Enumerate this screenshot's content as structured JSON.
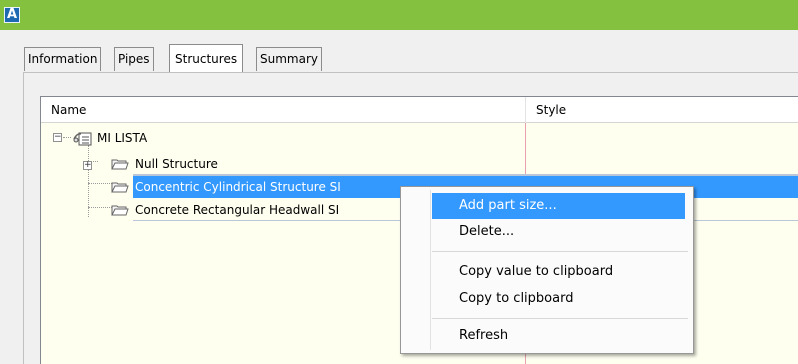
{
  "app": {
    "icon_letter": "A"
  },
  "tabs": [
    {
      "label": "Information"
    },
    {
      "label": "Pipes"
    },
    {
      "label": "Structures"
    },
    {
      "label": "Summary"
    }
  ],
  "grid": {
    "columns": {
      "name": "Name",
      "style": "Style"
    },
    "rows": [
      {
        "label": "MI LISTA"
      },
      {
        "label": "Null Structure"
      },
      {
        "label": "Concentric Cylindrical Structure SI"
      },
      {
        "label": "Concrete Rectangular Headwall SI"
      }
    ]
  },
  "context_menu": {
    "items": [
      {
        "label": "Add part size..."
      },
      {
        "label": "Delete..."
      },
      {
        "label": "Copy value to clipboard"
      },
      {
        "label": "Copy to clipboard"
      },
      {
        "label": "Refresh"
      }
    ]
  },
  "colors": {
    "titlebar": "#84c13f",
    "selection": "#3399ff",
    "grid_bg": "#fffff0"
  }
}
